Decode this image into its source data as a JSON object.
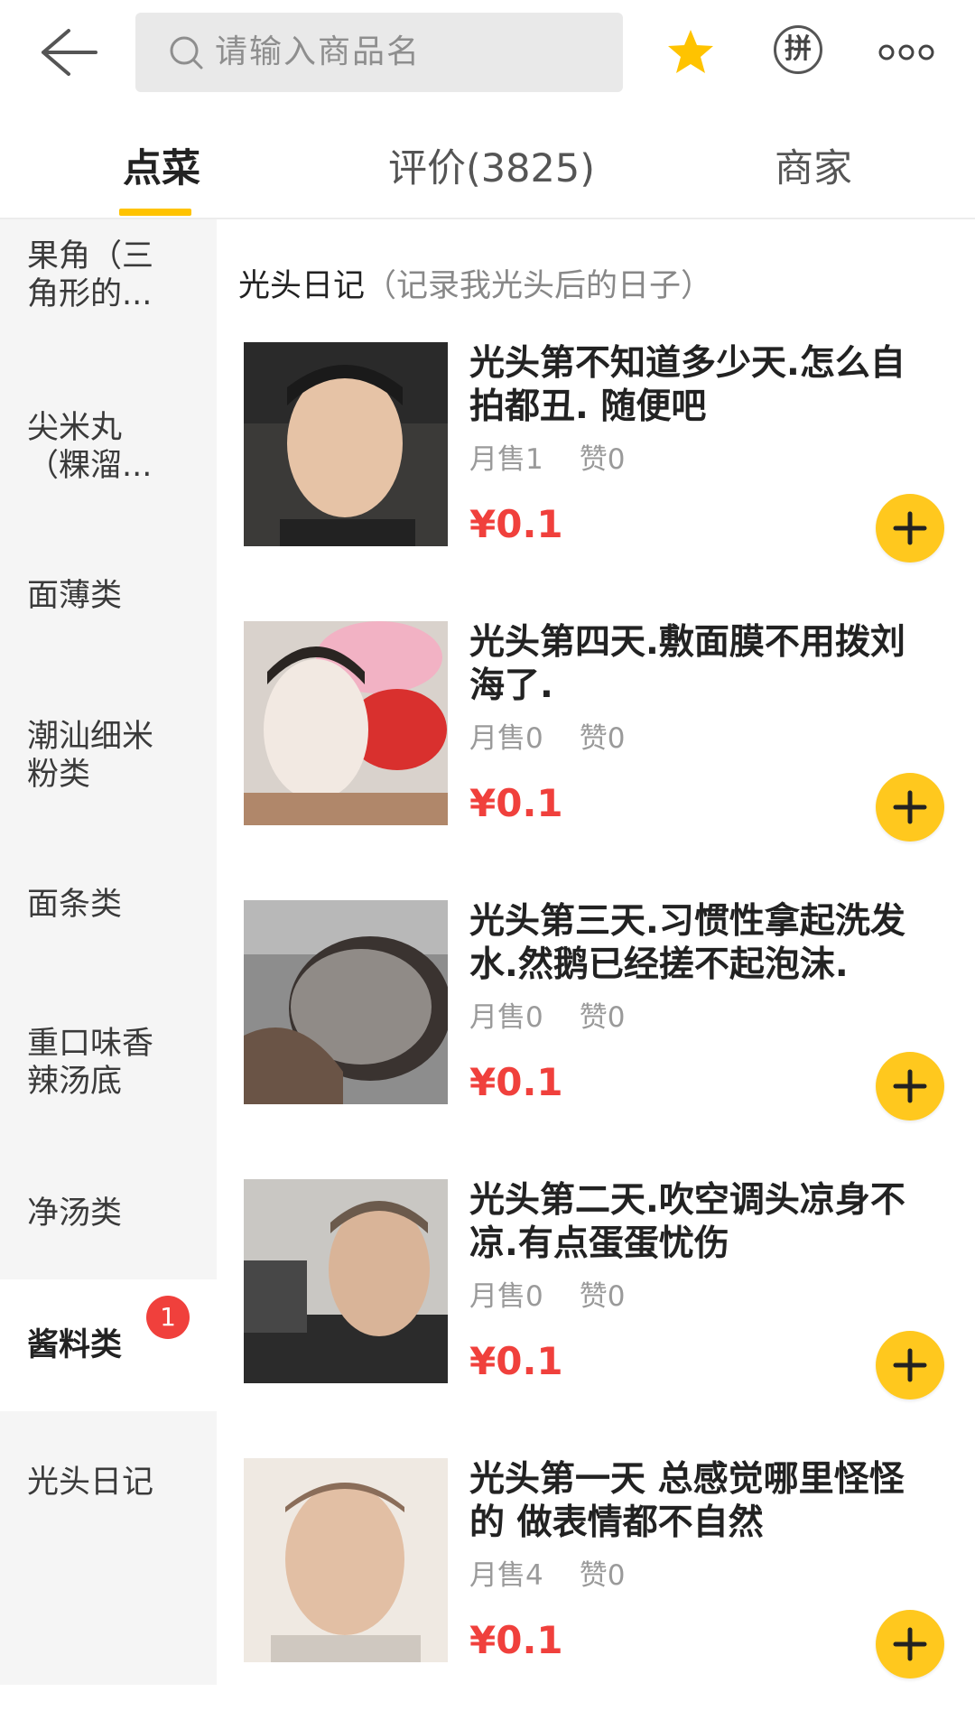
{
  "header": {
    "search_placeholder": "请输入商品名",
    "pin_label": "拼"
  },
  "tabs": [
    {
      "label": "点菜",
      "active": true
    },
    {
      "label": "评价(3825)",
      "active": false
    },
    {
      "label": "商家",
      "active": false
    }
  ],
  "sidebar": {
    "categories": [
      {
        "label": "果角（三角形的..."
      },
      {
        "label": "尖米丸（粿溜..."
      },
      {
        "label": "面薄类"
      },
      {
        "label": "潮汕细米粉类"
      },
      {
        "label": "面条类"
      },
      {
        "label": "重口味香辣汤底"
      },
      {
        "label": "净汤类"
      },
      {
        "label": "酱料类",
        "badge": "1",
        "active": true
      },
      {
        "label": "光头日记"
      }
    ]
  },
  "section": {
    "name": "光头日记",
    "description": "（记录我光头后的日子）"
  },
  "items": [
    {
      "title": "光头第不知道多少天.怎么自拍都丑. 随便吧",
      "monthly_sales": "月售1",
      "likes": "赞0",
      "price": "¥0.1"
    },
    {
      "title": "光头第四天.敷面膜不用拨刘海了.",
      "monthly_sales": "月售0",
      "likes": "赞0",
      "price": "¥0.1"
    },
    {
      "title": "光头第三天.习惯性拿起洗发水.然鹅已经搓不起泡沫.",
      "monthly_sales": "月售0",
      "likes": "赞0",
      "price": "¥0.1"
    },
    {
      "title": "光头第二天.吹空调头凉身不凉.有点蛋蛋忧伤",
      "monthly_sales": "月售0",
      "likes": "赞0",
      "price": "¥0.1"
    },
    {
      "title": "光头第一天 总感觉哪里怪怪的 做表情都不自然",
      "monthly_sales": "月售4",
      "likes": "赞0",
      "price": "¥0.1"
    }
  ],
  "colors": {
    "accent": "#ffc300",
    "price": "#f0403c",
    "badge": "#f0403c",
    "add_button": "#ffc81e"
  }
}
